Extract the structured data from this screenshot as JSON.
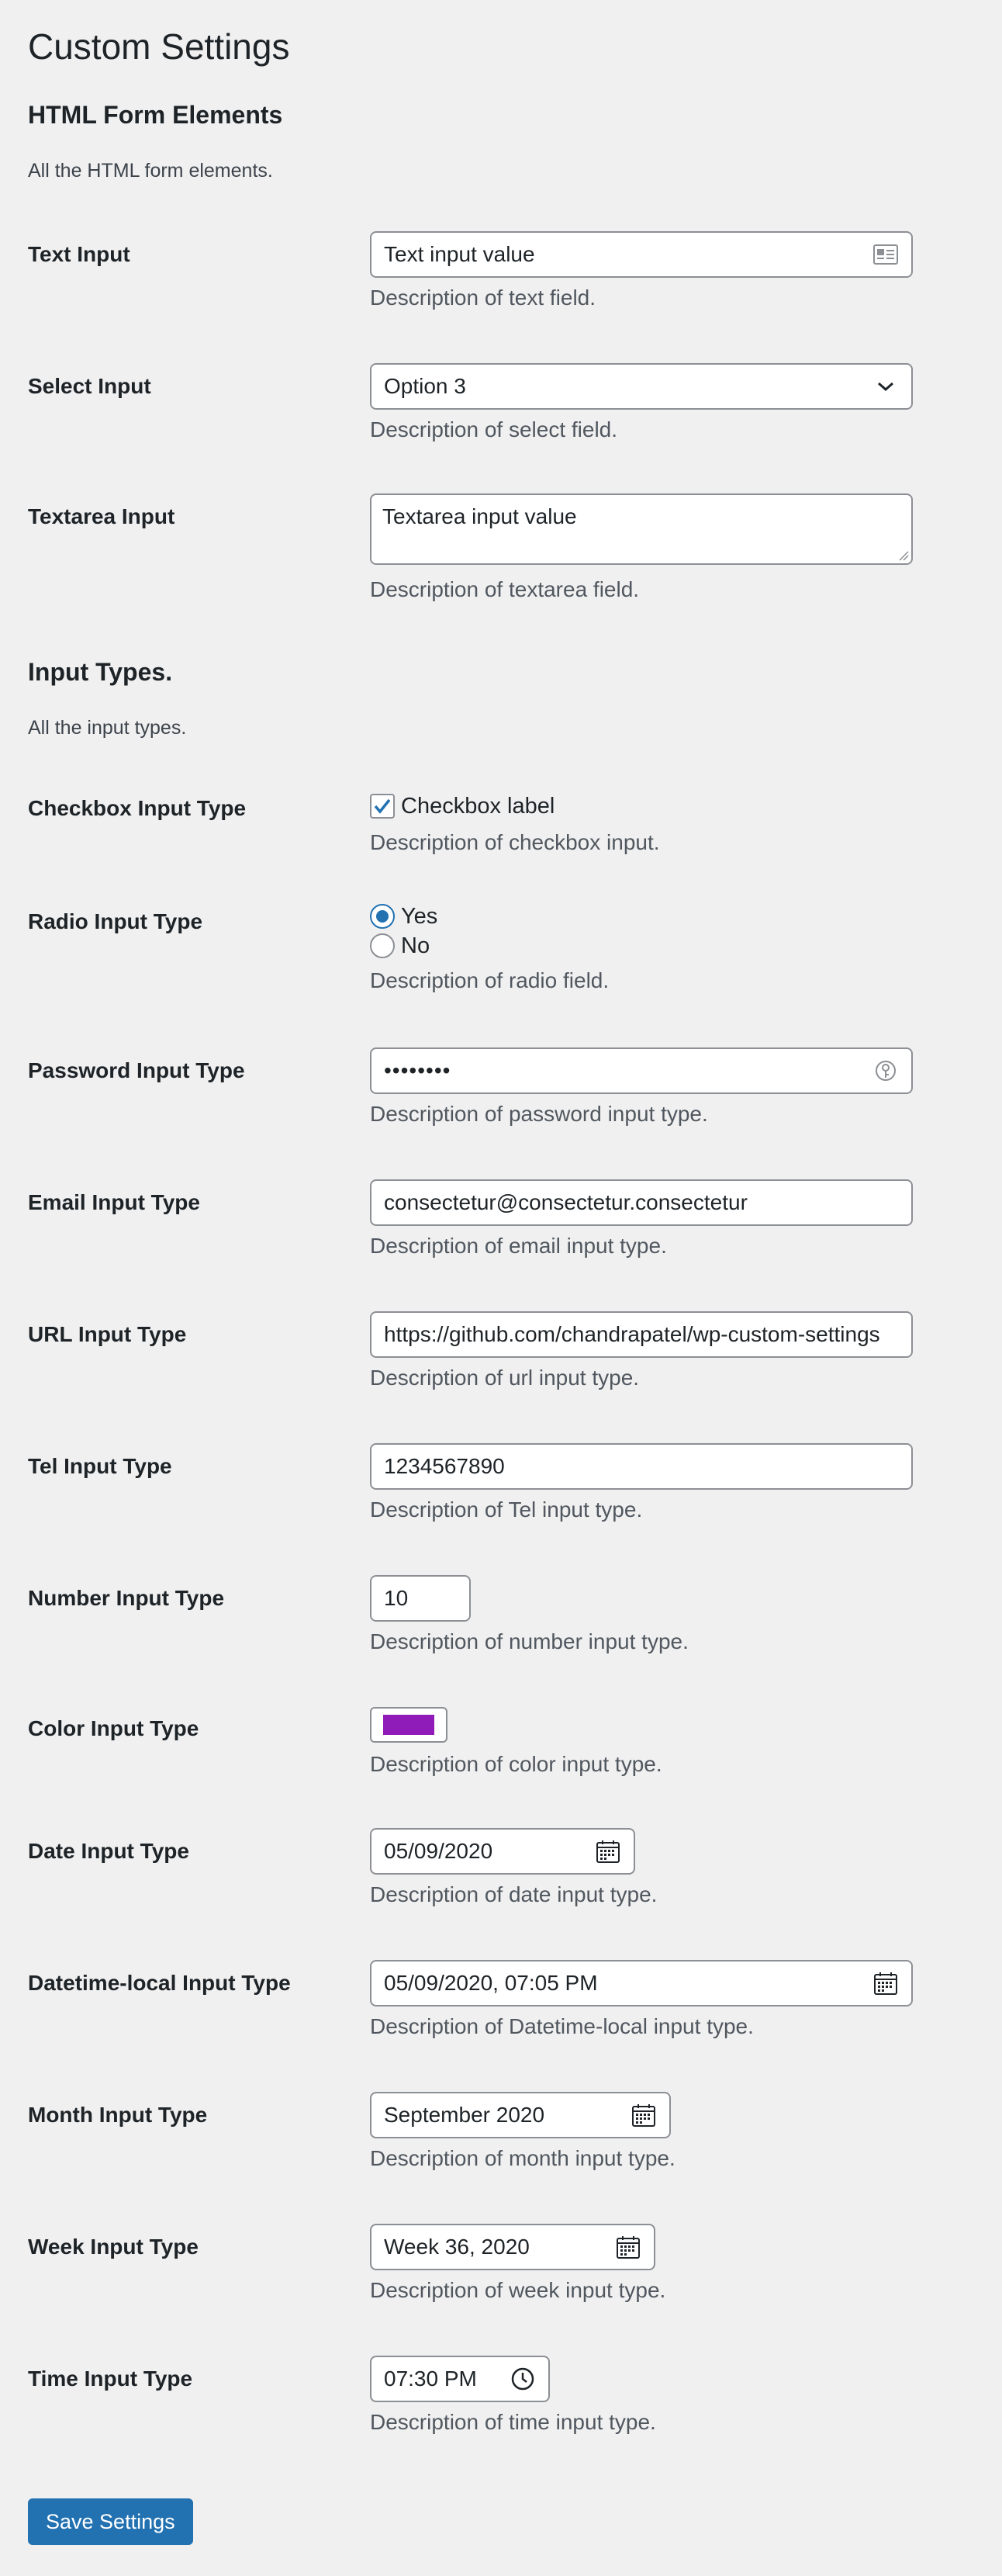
{
  "page": {
    "title": "Custom Settings"
  },
  "sections": {
    "form_elements": {
      "title": "HTML Form Elements",
      "description": "All the HTML form elements."
    },
    "input_types": {
      "title": "Input Types.",
      "description": "All the input types."
    }
  },
  "fields": {
    "text": {
      "label": "Text Input",
      "value": "Text input value",
      "description": "Description of text field."
    },
    "select": {
      "label": "Select Input",
      "value": "Option 3",
      "description": "Description of select field."
    },
    "textarea": {
      "label": "Textarea Input",
      "value": "Textarea input value",
      "description": "Description of textarea field."
    },
    "checkbox": {
      "label": "Checkbox Input Type",
      "option_label": "Checkbox label",
      "checked": true,
      "description": "Description of checkbox input."
    },
    "radio": {
      "label": "Radio Input Type",
      "options": [
        "Yes",
        "No"
      ],
      "selected": "Yes",
      "description": "Description of radio field."
    },
    "password": {
      "label": "Password Input Type",
      "value": "••••••••",
      "description": "Description of password input type."
    },
    "email": {
      "label": "Email Input Type",
      "value": "consectetur@consectetur.consectetur",
      "description": "Description of email input type."
    },
    "url": {
      "label": "URL Input Type",
      "value": "https://github.com/chandrapatel/wp-custom-settings",
      "description": "Description of url input type."
    },
    "tel": {
      "label": "Tel Input Type",
      "value": "1234567890",
      "description": "Description of Tel input type."
    },
    "number": {
      "label": "Number Input Type",
      "value": "10",
      "description": "Description of number input type."
    },
    "color": {
      "label": "Color Input Type",
      "value": "#8f1bb8",
      "description": "Description of color input type."
    },
    "date": {
      "label": "Date Input Type",
      "value": "05/09/2020",
      "description": "Description of date input type."
    },
    "datetime": {
      "label": "Datetime-local Input Type",
      "value": "05/09/2020, 07:05 PM",
      "description": "Description of Datetime-local input type."
    },
    "month": {
      "label": "Month Input Type",
      "value": "September 2020",
      "description": "Description of month input type."
    },
    "week": {
      "label": "Week Input Type",
      "value": "Week 36, 2020",
      "description": "Description of week input type."
    },
    "time": {
      "label": "Time Input Type",
      "value": "07:30 PM",
      "description": "Description of time input type."
    }
  },
  "actions": {
    "save_label": "Save Settings"
  },
  "icons": {
    "text_field": "contact-card-icon",
    "select": "chevron-down-icon",
    "password": "key-icon",
    "calendar": "calendar-icon",
    "time": "clock-icon",
    "checkbox": "checkmark-icon"
  },
  "colors": {
    "accent": "#2271b1",
    "background": "#f0f0f1",
    "color_value": "#8f1bb8"
  }
}
